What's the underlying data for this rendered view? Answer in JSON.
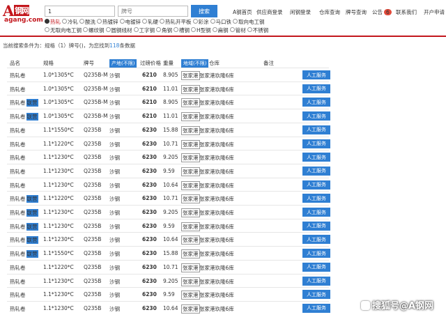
{
  "logo": {
    "letter": "A",
    "name": "钢网",
    "domain": "agang.com"
  },
  "search": {
    "spec_value": "1",
    "grade_placeholder": "牌号",
    "button": "搜索"
  },
  "topnav": [
    {
      "label": "A钢首页"
    },
    {
      "label": "供应商登录"
    },
    {
      "label": "闲钢登录"
    },
    {
      "label": "仓库查询"
    },
    {
      "label": "牌号查询"
    },
    {
      "label": "公告",
      "badge": "6"
    },
    {
      "label": "联系我们"
    },
    {
      "label": "开户申请"
    }
  ],
  "categories": {
    "row1": [
      "热轧",
      "冷轧",
      "酸洗",
      "热镀锌",
      "电镀锌",
      "轧硬",
      "热轧开平板",
      "彩涂",
      "马口铁",
      "取向电工钢"
    ],
    "row2": [
      "无取向电工钢",
      "螺纹钢",
      "圆钢线材",
      "工字钢",
      "角钢",
      "槽钢",
      "H型钢",
      "扁钢",
      "管材",
      "不锈钢"
    ],
    "selected": "热轧"
  },
  "result": {
    "prefix": "当前搜索条件为：规格（1）牌号()，为您找到",
    "count": "118",
    "suffix": "条数据"
  },
  "table": {
    "headers": {
      "name": "品名",
      "spec": "规格",
      "grade": "牌号",
      "origin": "产地(不限)",
      "price": "过磅价格",
      "weight": "重量",
      "region": "地域(不限)",
      "warehouse": "仓库",
      "note": "备注"
    },
    "rows": [
      {
        "name": "热轧卷",
        "tag": "",
        "spec": "1.0*1305*C",
        "grade": "Q235B-M",
        "material": "沙钢",
        "price": "6210",
        "weight": "8.905",
        "city": "张家港",
        "warehouse": "张家港玖隆6库",
        "action": "人工服务"
      },
      {
        "name": "热轧卷",
        "tag": "",
        "spec": "1.0*1305*C",
        "grade": "Q235B-M",
        "material": "沙钢",
        "price": "6210",
        "weight": "11.01",
        "city": "张家港",
        "warehouse": "张家港玖隆6库",
        "action": "人工服务"
      },
      {
        "name": "热轧卷",
        "tag": "联营",
        "spec": "1.0*1305*C",
        "grade": "Q235B-M",
        "material": "沙钢",
        "price": "6210",
        "weight": "8.905",
        "city": "张家港",
        "warehouse": "张家港玖隆6库",
        "action": "人工服务"
      },
      {
        "name": "热轧卷",
        "tag": "联营",
        "spec": "1.0*1305*C",
        "grade": "Q235B-M",
        "material": "沙钢",
        "price": "6210",
        "weight": "11.01",
        "city": "张家港",
        "warehouse": "张家港玖隆6库",
        "action": "人工服务"
      },
      {
        "name": "热轧卷",
        "tag": "",
        "spec": "1.1*1550*C",
        "grade": "Q235B",
        "material": "沙钢",
        "price": "6230",
        "weight": "15.88",
        "city": "张家港",
        "warehouse": "张家港玖隆6库",
        "action": "人工服务"
      },
      {
        "name": "热轧卷",
        "tag": "",
        "spec": "1.1*1220*C",
        "grade": "Q235B",
        "material": "沙钢",
        "price": "6230",
        "weight": "10.71",
        "city": "张家港",
        "warehouse": "张家港玖隆6库",
        "action": "人工服务"
      },
      {
        "name": "热轧卷",
        "tag": "",
        "spec": "1.1*1230*C",
        "grade": "Q235B",
        "material": "沙钢",
        "price": "6230",
        "weight": "9.205",
        "city": "张家港",
        "warehouse": "张家港玖隆6库",
        "action": "人工服务"
      },
      {
        "name": "热轧卷",
        "tag": "",
        "spec": "1.1*1230*C",
        "grade": "Q235B",
        "material": "沙钢",
        "price": "6230",
        "weight": "9.59",
        "city": "张家港",
        "warehouse": "张家港玖隆6库",
        "action": "人工服务"
      },
      {
        "name": "热轧卷",
        "tag": "",
        "spec": "1.1*1230*C",
        "grade": "Q235B",
        "material": "沙钢",
        "price": "6230",
        "weight": "10.64",
        "city": "张家港",
        "warehouse": "张家港玖隆6库",
        "action": "人工服务"
      },
      {
        "name": "热轧卷",
        "tag": "联营",
        "spec": "1.1*1220*C",
        "grade": "Q235B",
        "material": "沙钢",
        "price": "6230",
        "weight": "10.71",
        "city": "张家港",
        "warehouse": "张家港玖隆6库",
        "action": "人工服务"
      },
      {
        "name": "热轧卷",
        "tag": "联营",
        "spec": "1.1*1230*C",
        "grade": "Q235B",
        "material": "沙钢",
        "price": "6230",
        "weight": "9.205",
        "city": "张家港",
        "warehouse": "张家港玖隆6库",
        "action": "人工服务"
      },
      {
        "name": "热轧卷",
        "tag": "联营",
        "spec": "1.1*1230*C",
        "grade": "Q235B",
        "material": "沙钢",
        "price": "6230",
        "weight": "9.59",
        "city": "张家港",
        "warehouse": "张家港玖隆6库",
        "action": "人工服务"
      },
      {
        "name": "热轧卷",
        "tag": "联营",
        "spec": "1.1*1230*C",
        "grade": "Q235B",
        "material": "沙钢",
        "price": "6230",
        "weight": "10.64",
        "city": "张家港",
        "warehouse": "张家港玖隆6库",
        "action": "人工服务"
      },
      {
        "name": "热轧卷",
        "tag": "联营",
        "spec": "1.1*1550*C",
        "grade": "Q235B",
        "material": "沙钢",
        "price": "6230",
        "weight": "15.88",
        "city": "张家港",
        "warehouse": "张家港玖隆6库",
        "action": "人工服务"
      },
      {
        "name": "热轧卷",
        "tag": "",
        "spec": "1.1*1220*C",
        "grade": "Q235B",
        "material": "沙钢",
        "price": "6230",
        "weight": "10.71",
        "city": "张家港",
        "warehouse": "张家港玖隆6库",
        "action": "人工服务"
      },
      {
        "name": "热轧卷",
        "tag": "",
        "spec": "1.1*1230*C",
        "grade": "Q235B",
        "material": "沙钢",
        "price": "6230",
        "weight": "9.205",
        "city": "张家港",
        "warehouse": "张家港玖隆6库",
        "action": "人工服务"
      },
      {
        "name": "热轧卷",
        "tag": "",
        "spec": "1.1*1230*C",
        "grade": "Q235B",
        "material": "沙钢",
        "price": "6230",
        "weight": "9.59",
        "city": "张家港",
        "warehouse": "张家港玖隆6库",
        "action": "人工服务"
      },
      {
        "name": "热轧卷",
        "tag": "",
        "spec": "1.1*1230*C",
        "grade": "Q235B",
        "material": "沙钢",
        "price": "6230",
        "weight": "10.64",
        "city": "张家港",
        "warehouse": "张家港玖隆6库",
        "action": "人工服务"
      }
    ]
  },
  "watermark": {
    "text": "搜狐号@A钢网"
  },
  "colors": {
    "brand_red": "#c3161c",
    "accent_blue": "#2f7fd3"
  }
}
